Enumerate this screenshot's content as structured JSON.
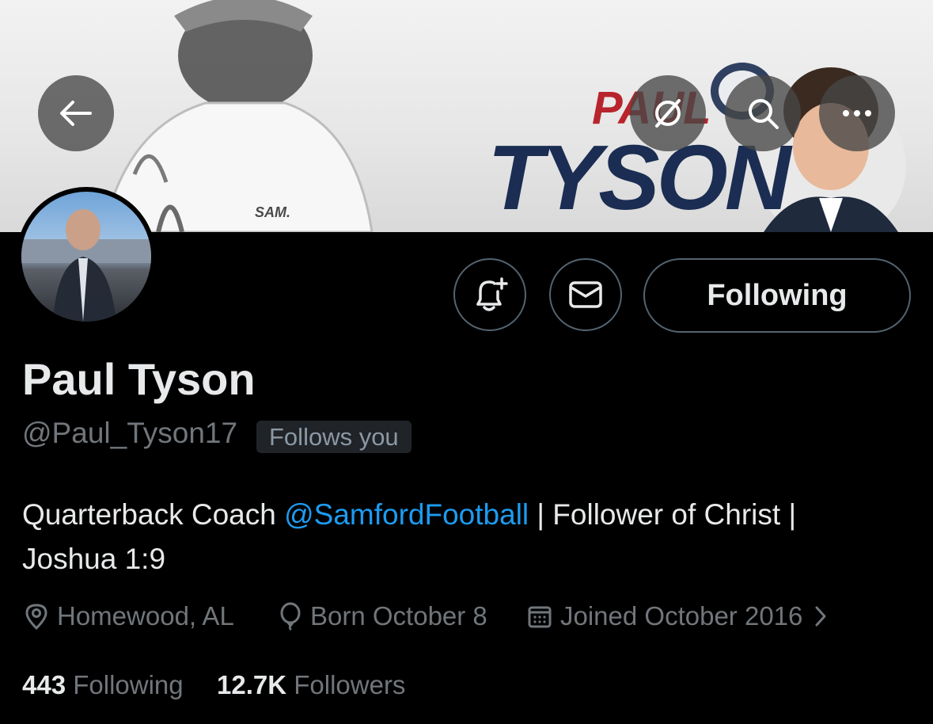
{
  "banner": {
    "name_first": "PAUL",
    "name_last": "TYSON",
    "shirt_logo": "SAM."
  },
  "toolbar": {
    "back_icon": "back-arrow-icon",
    "grok_icon": "slash-circle-icon",
    "search_icon": "search-icon",
    "more_icon": "more-icon"
  },
  "profile": {
    "display_name": "Paul Tyson",
    "handle": "@Paul_Tyson17",
    "follows_you": "Follows you",
    "bio_prefix": "Quarterback Coach ",
    "bio_mention": "@SamfordFootball",
    "bio_line1_suffix": " | Follower of Christ |",
    "bio_line2": "Joshua 1:9",
    "location": "Homewood, AL",
    "birthday": "Born October 8",
    "joined": "Joined October 2016"
  },
  "actions": {
    "notify_icon": "bell-plus-icon",
    "message_icon": "envelope-icon",
    "following_label": "Following"
  },
  "stats": {
    "following_count": "443",
    "following_label": "Following",
    "followers_count": "12.7K",
    "followers_label": "Followers"
  },
  "colors": {
    "background": "#000000",
    "text": "#e7e9ea",
    "secondary_text": "#71767b",
    "link": "#1d9bf0",
    "banner_red": "#b8242c",
    "banner_navy": "#1b2d52"
  }
}
